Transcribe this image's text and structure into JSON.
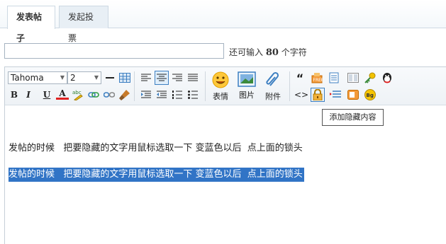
{
  "tabs": [
    {
      "label": "发表帖子",
      "active": true
    },
    {
      "label": "发起投票",
      "active": false
    }
  ],
  "subject": {
    "value": "",
    "placeholder": ""
  },
  "char_counter": {
    "prefix": "还可输入",
    "count": "80",
    "suffix": "个字符"
  },
  "toolbar": {
    "font_family": "Tahoma",
    "font_size": "2",
    "bold": "B",
    "italic": "I",
    "underline": "U",
    "font_color": "A",
    "smile_label": "表情",
    "image_label": "图片",
    "attach_label": "附件",
    "quote": "“",
    "code": "<>"
  },
  "tooltip": "添加隐藏内容",
  "content": {
    "line1": "发帖的时候   把要隐藏的文字用鼠标选取一下 变蓝色以后  点上面的锁头",
    "line2": "发帖的时候   把要隐藏的文字用鼠标选取一下 变蓝色以后  点上面的锁头"
  },
  "colors": {
    "selection": "#3174c6",
    "tab_border": "#cdd9e3"
  }
}
